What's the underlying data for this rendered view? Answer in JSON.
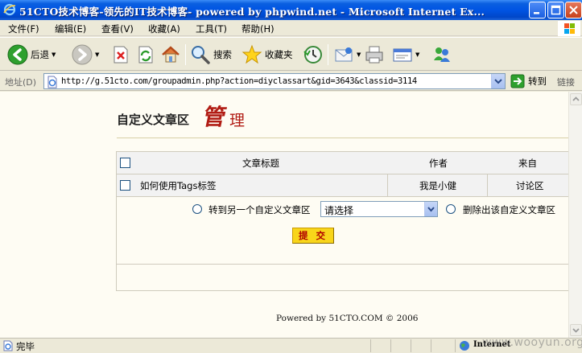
{
  "window": {
    "title": "51CTO技术博客-领先的IT技术博客- powered by phpwind.net - Microsoft Internet Ex..."
  },
  "menu": [
    "文件(F)",
    "编辑(E)",
    "查看(V)",
    "收藏(A)",
    "工具(T)",
    "帮助(H)"
  ],
  "toolbar": {
    "back_label": "后退",
    "search_label": "搜索",
    "favorites_label": "收藏夹"
  },
  "address": {
    "label": "地址(D)",
    "url": "http://g.51cto.com/groupadmin.php?action=diyclassart&gid=3643&classid=3114",
    "go_label": "转到",
    "links_label": "链接"
  },
  "page": {
    "title": "自定义文章区",
    "title_glyph_1": "管",
    "title_glyph_2": "理",
    "table": {
      "headers": [
        "文章标题",
        "作者",
        "来自"
      ],
      "rows": [
        {
          "title": "如何使用Tags标签",
          "author": "我是小健",
          "from": "讨论区"
        }
      ]
    },
    "move_option_label": "转到另一个自定义文章区",
    "select_value": "请选择",
    "remove_option_label": "删除出该自定义文章区",
    "submit_label": "提 交",
    "footer": "Powered by 51CTO.COM © 2006"
  },
  "status": {
    "text": "完毕",
    "zone": "Internet",
    "watermark": "www.wooyun.org"
  }
}
